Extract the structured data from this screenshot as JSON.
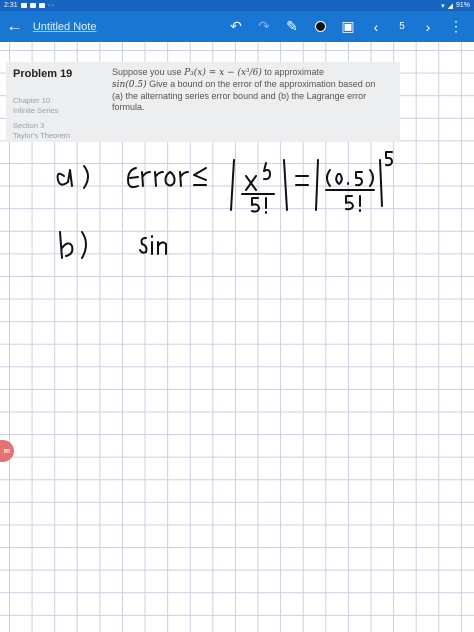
{
  "status": {
    "time": "2:31",
    "battery": "91%"
  },
  "toolbar": {
    "note_title": "Untitled Note",
    "page_number": "5"
  },
  "problem": {
    "title": "Problem 19",
    "chapter": "Chapter 10",
    "chapter_name": "Infinite Series",
    "section": "Section 3",
    "section_name": "Taylor's Theorem",
    "text_1": "Suppose you use",
    "formula": "P₃(x) = x − (x³/6)",
    "text_2": "to approximate",
    "sin_expr": "sin(0.5)",
    "text_3": "Give a bound on the error of the approximation based on",
    "text_4": "(a) the alternating series error bound and (b) the Lagrange error formula."
  },
  "side_tab": {
    "label": "m"
  },
  "colors": {
    "app_bar": "#1976d2",
    "status_bar": "#1565c0",
    "grid": "#c9cfe0",
    "card": "#eceef0",
    "ink": "#111111"
  }
}
